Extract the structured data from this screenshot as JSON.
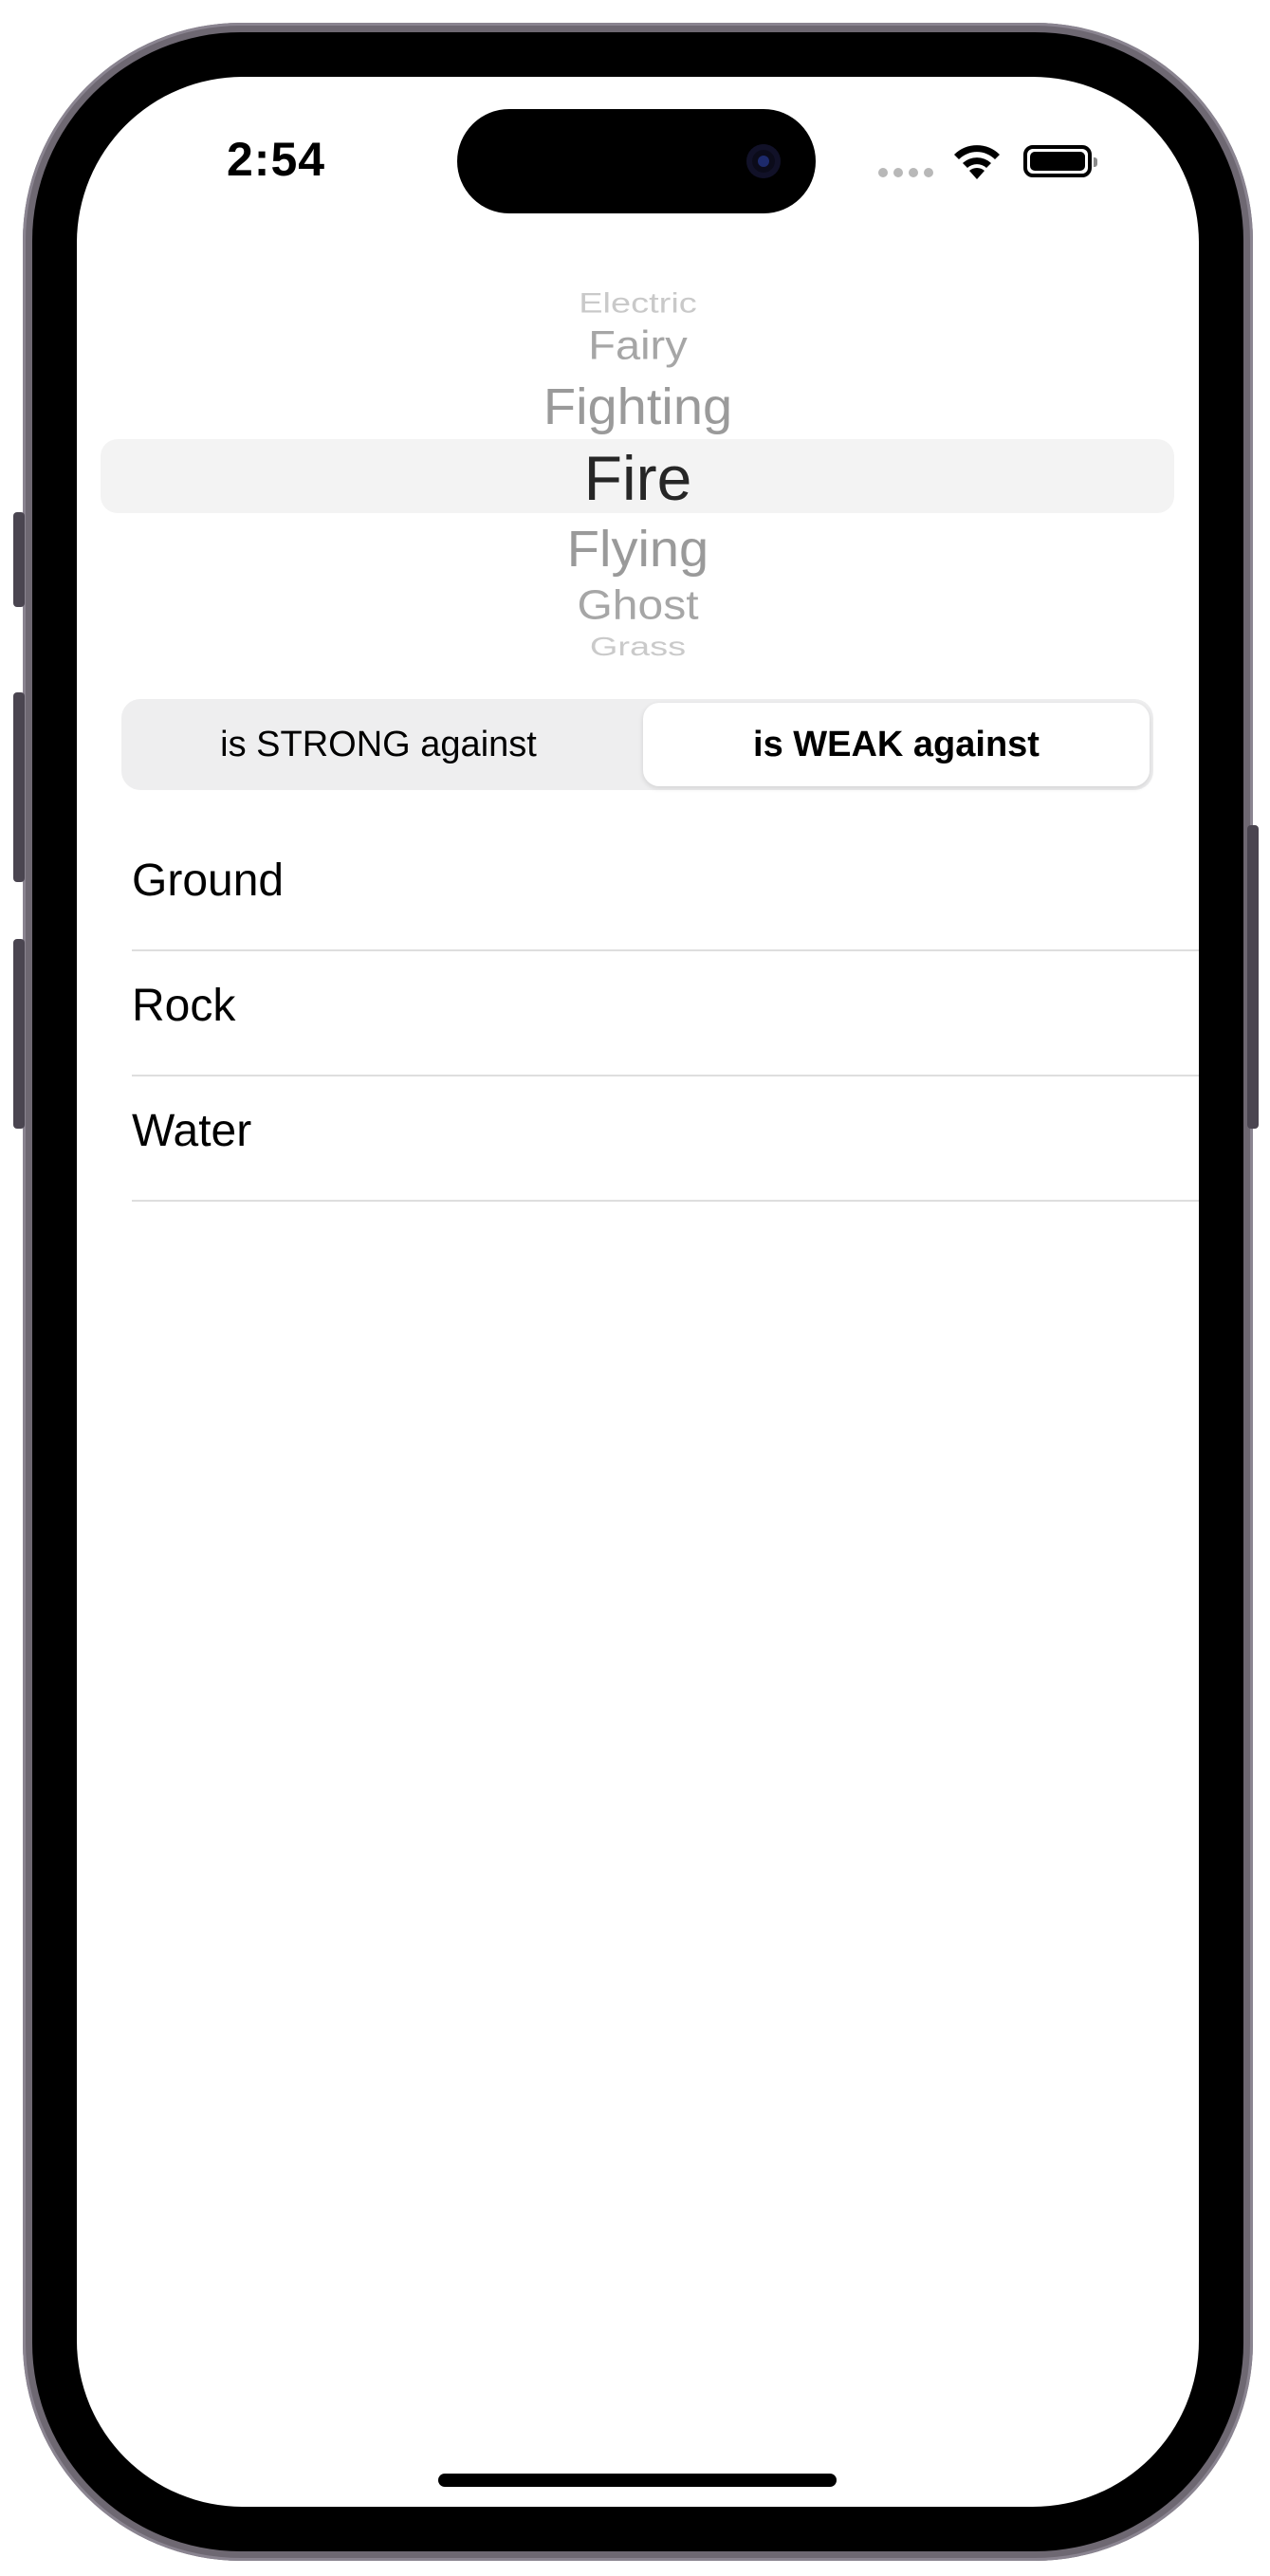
{
  "status_bar": {
    "time": "2:54",
    "icons": [
      "cellular-signal-icon",
      "wifi-icon",
      "battery-icon"
    ]
  },
  "picker": {
    "items": [
      "Electric",
      "Fairy",
      "Fighting",
      "Fire",
      "Flying",
      "Ghost",
      "Grass"
    ],
    "selected": "Fire"
  },
  "segmented_control": {
    "options": [
      "is STRONG against",
      "is WEAK against"
    ],
    "selected": "is WEAK against"
  },
  "results": {
    "items": [
      "Ground",
      "Rock",
      "Water"
    ]
  },
  "colors": {
    "selected_row": "#f3f3f3",
    "segment_track": "#eeeeef",
    "separator": "#dedede"
  }
}
